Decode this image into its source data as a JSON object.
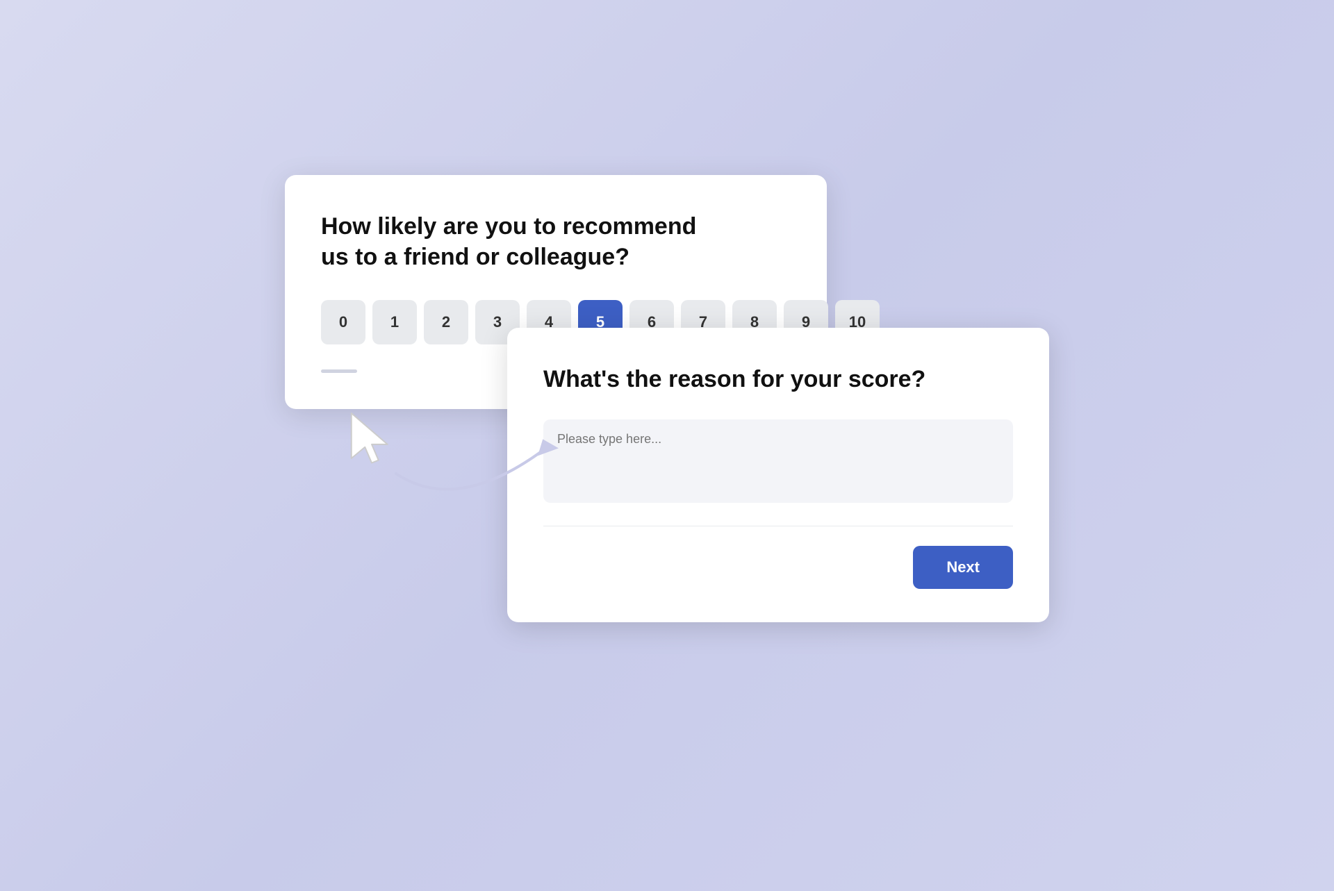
{
  "background": {
    "color": "#cdd0ea"
  },
  "card_nps": {
    "question": "How likely are you to recommend us to a friend or colleague?",
    "scale": [
      0,
      1,
      2,
      3,
      4,
      5,
      6,
      7,
      8,
      9,
      10
    ],
    "selected": 5
  },
  "card_reason": {
    "question": "What's the reason for your score?",
    "textarea_placeholder": "Please type here...",
    "next_button_label": "Next"
  }
}
